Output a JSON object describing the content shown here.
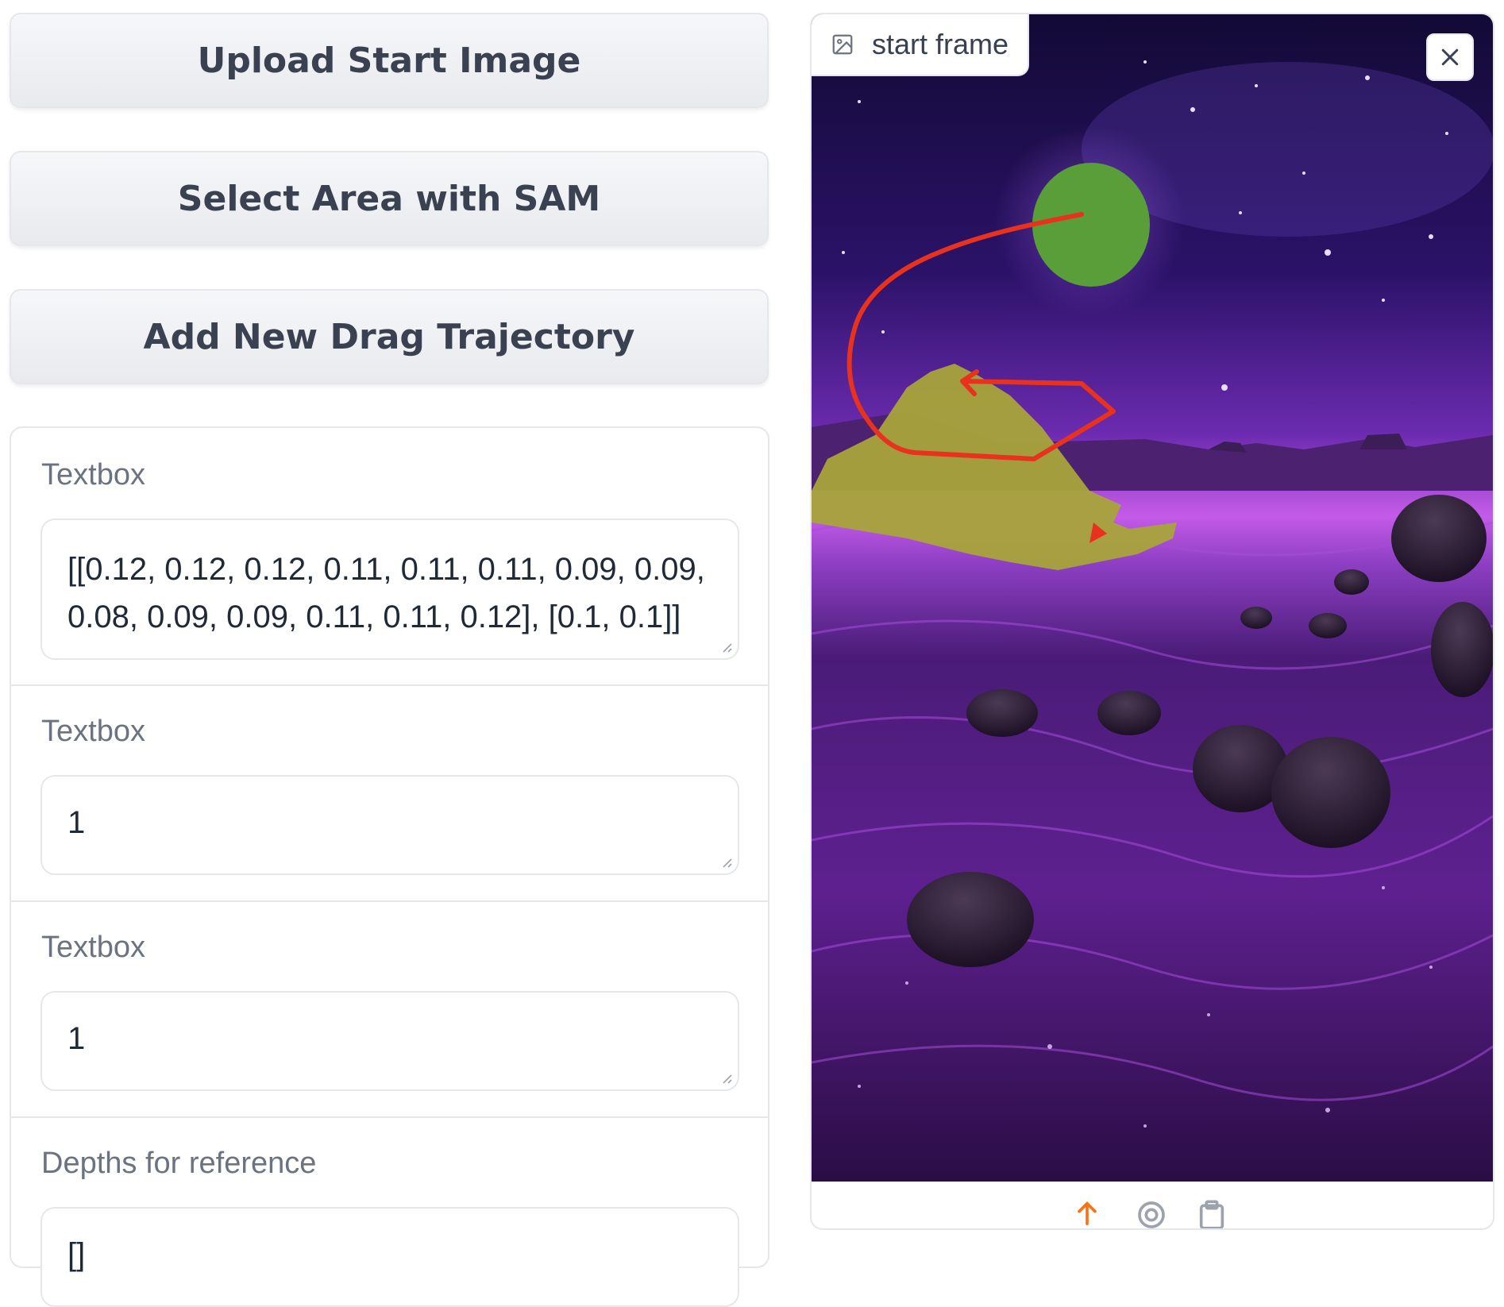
{
  "buttons": {
    "upload": "Upload Start Image",
    "select_sam": "Select Area with SAM",
    "add_trajectory": "Add New Drag Trajectory"
  },
  "fields": [
    {
      "label": "Textbox",
      "value": "[[0.12, 0.12, 0.12, 0.11, 0.11, 0.11, 0.09, 0.09, 0.08, 0.09, 0.09, 0.11, 0.11, 0.12], [0.1, 0.1]]"
    },
    {
      "label": "Textbox",
      "value": "1"
    },
    {
      "label": "Textbox",
      "value": "1"
    },
    {
      "label": "Depths for reference",
      "value": "[]"
    }
  ],
  "image_panel": {
    "label": "start frame",
    "icons": [
      "image-icon",
      "close-icon",
      "upload-icon",
      "webcam-icon",
      "clipboard-icon"
    ],
    "accent_color": "#f97316"
  }
}
